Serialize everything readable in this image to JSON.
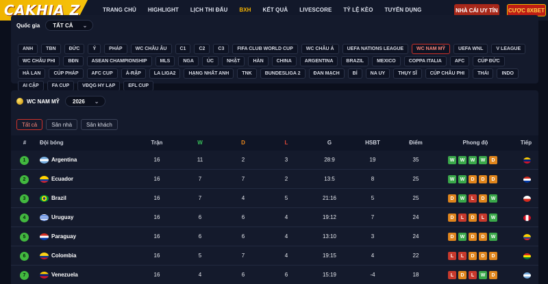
{
  "header": {
    "logo": "CAKHIA Z",
    "nav": [
      "TRANG CHỦ",
      "HIGHLIGHT",
      "LỊCH THI ĐẤU",
      "BXH",
      "KẾT QUẢ",
      "LIVESCORE",
      "TỶ LỆ KÈO",
      "TUYỂN DỤNG"
    ],
    "active_nav": "BXH",
    "btn_nha": "NHÀ CÁI UY TÍN",
    "btn_cuoc": "CƯỢC 8XBET"
  },
  "filter": {
    "country_label": "Quốc gia",
    "country_value": "TẤT CẢ",
    "chips": [
      "ANH",
      "TBN",
      "ĐỨC",
      "Ý",
      "PHÁP",
      "WC CHÂU ÂU",
      "C1",
      "C2",
      "C3",
      "FIFA CLUB WORLD CUP",
      "WC CHÂU Á",
      "UEFA NATIONS LEAGUE",
      "WC NAM MỸ",
      "UEFA WNL",
      "V LEAGUE",
      "WC CHÂU PHI",
      "BĐN",
      "ASEAN CHAMPIONSHIP",
      "MLS",
      "NGA",
      "ÚC",
      "NHẬT",
      "HÀN",
      "CHINA",
      "ARGENTINA",
      "BRAZIL",
      "MEXICO",
      "COPPA ITALIA",
      "AFC",
      "CÚP ĐỨC",
      "HÀ LAN",
      "CÚP PHÁP",
      "AFC CUP",
      "Ả-RẬP",
      "LA LIGA2",
      "HẠNG NHẤT ANH",
      "TNK",
      "BUNDESLIGA 2",
      "ĐAN MẠCH",
      "BỈ",
      "NA UY",
      "THỤY SĨ",
      "CÚP CHÂU PHI",
      "THÁI",
      "INDO",
      "AI CẬP",
      "FA CUP",
      "VĐQG HY LẠP",
      "EFL CUP"
    ],
    "active_chip": "WC NAM MỸ"
  },
  "standings": {
    "league": "WC NAM MỸ",
    "season": "2026",
    "tabs": [
      "Tất cả",
      "Sân nhà",
      "Sân khách"
    ],
    "active_tab": "Tất cả",
    "headers": {
      "rank": "#",
      "team": "Đội bóng",
      "played": "Trận",
      "w": "W",
      "d": "D",
      "l": "L",
      "g": "G",
      "gd": "HSBT",
      "pts": "Điểm",
      "form": "Phong độ",
      "next": "Tiếp"
    },
    "rows": [
      {
        "rank": "1",
        "team": "Argentina",
        "played": "16",
        "w": "11",
        "d": "2",
        "l": "3",
        "g": "28:9",
        "gd": "19",
        "pts": "35",
        "form": [
          "W",
          "W",
          "W",
          "W",
          "D"
        ],
        "flag": "argentina",
        "next": "venezuela"
      },
      {
        "rank": "2",
        "team": "Ecuador",
        "played": "16",
        "w": "7",
        "d": "7",
        "l": "2",
        "g": "13:5",
        "gd": "8",
        "pts": "25",
        "form": [
          "W",
          "W",
          "D",
          "D",
          "D"
        ],
        "flag": "ecuador",
        "next": "paraguay"
      },
      {
        "rank": "3",
        "team": "Brazil",
        "played": "16",
        "w": "7",
        "d": "4",
        "l": "5",
        "g": "21:16",
        "gd": "5",
        "pts": "25",
        "form": [
          "D",
          "W",
          "L",
          "D",
          "W"
        ],
        "flag": "brazil",
        "next": "chile"
      },
      {
        "rank": "4",
        "team": "Uruguay",
        "played": "16",
        "w": "6",
        "d": "6",
        "l": "4",
        "g": "19:12",
        "gd": "7",
        "pts": "24",
        "form": [
          "D",
          "L",
          "D",
          "L",
          "W"
        ],
        "flag": "uruguay",
        "next": "peru"
      },
      {
        "rank": "5",
        "team": "Paraguay",
        "played": "16",
        "w": "6",
        "d": "6",
        "l": "4",
        "g": "13:10",
        "gd": "3",
        "pts": "24",
        "form": [
          "D",
          "W",
          "D",
          "D",
          "W"
        ],
        "flag": "paraguay",
        "next": "ecuador"
      },
      {
        "rank": "6",
        "team": "Colombia",
        "played": "16",
        "w": "5",
        "d": "7",
        "l": "4",
        "g": "19:15",
        "gd": "4",
        "pts": "22",
        "form": [
          "L",
          "L",
          "D",
          "D",
          "D"
        ],
        "flag": "colombia",
        "next": "bolivia"
      },
      {
        "rank": "7",
        "team": "Venezuela",
        "played": "16",
        "w": "4",
        "d": "6",
        "l": "6",
        "g": "15:19",
        "gd": "-4",
        "pts": "18",
        "form": [
          "L",
          "D",
          "L",
          "W",
          "D"
        ],
        "flag": "venezuela",
        "next": "argentina"
      }
    ]
  },
  "colors": {
    "accent": "#f6b400",
    "win": "#3aa84a",
    "draw": "#e0851c",
    "loss": "#c8392c"
  }
}
